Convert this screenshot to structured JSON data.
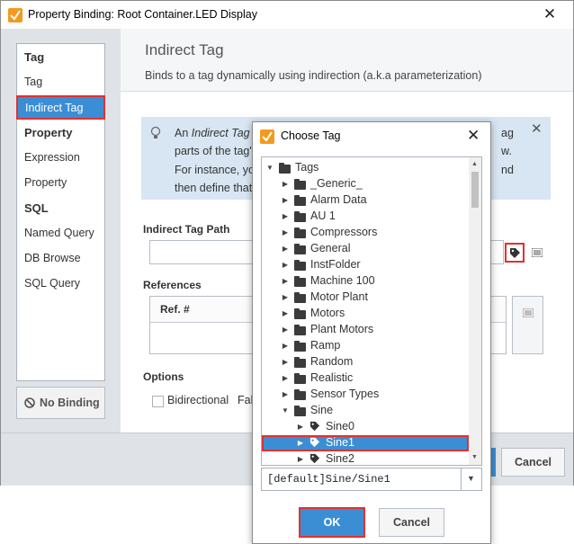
{
  "window": {
    "title": "Property Binding: Root Container.LED Display",
    "close_glyph": "✕"
  },
  "sidebar": {
    "tag_header": "Tag",
    "tag": "Tag",
    "indirect_tag": "Indirect Tag",
    "property_header": "Property",
    "expression": "Expression",
    "property": "Property",
    "sql_header": "SQL",
    "named_query": "Named Query",
    "db_browse": "DB Browse",
    "sql_query": "SQL Query",
    "no_binding": "No Binding"
  },
  "content": {
    "title": "Indirect Tag",
    "description": "Binds to a tag dynamically using indirection (a.k.a parameterization)",
    "info": {
      "line1_prefix": "An ",
      "line1_italic": "Indirect Tag B",
      "line1_tail": "ag",
      "line2_start": "parts of the tag'",
      "line2_end": "w.",
      "line3_start": "For instance, you",
      "line3_end": "nd",
      "line4_start": "then define that"
    },
    "indirect_tag_path_label": "Indirect Tag Path",
    "references_label": "References",
    "ref_col": "Ref. #",
    "options_label": "Options",
    "bidirectional_label": "Bidirectional",
    "fall_partial": "Fall"
  },
  "footer": {
    "cancel": "Cancel"
  },
  "dialog": {
    "title": "Choose Tag",
    "close_glyph": "✕",
    "tree": [
      {
        "label": "Tags",
        "icon": "folder-icon",
        "arrow": "expanded",
        "level": 0
      },
      {
        "label": "_Generic_",
        "icon": "folder-icon",
        "arrow": "collapsed",
        "level": 1
      },
      {
        "label": "Alarm Data",
        "icon": "folder-icon",
        "arrow": "collapsed",
        "level": 1
      },
      {
        "label": "AU 1",
        "icon": "folder-icon",
        "arrow": "collapsed",
        "level": 1
      },
      {
        "label": "Compressors",
        "icon": "folder-icon",
        "arrow": "collapsed",
        "level": 1
      },
      {
        "label": "General",
        "icon": "folder-icon",
        "arrow": "collapsed",
        "level": 1
      },
      {
        "label": "InstFolder",
        "icon": "folder-icon",
        "arrow": "collapsed",
        "level": 1
      },
      {
        "label": "Machine 100",
        "icon": "folder-icon",
        "arrow": "collapsed",
        "level": 1
      },
      {
        "label": "Motor Plant",
        "icon": "folder-icon",
        "arrow": "collapsed",
        "level": 1
      },
      {
        "label": "Motors",
        "icon": "folder-icon",
        "arrow": "collapsed",
        "level": 1
      },
      {
        "label": "Plant Motors",
        "icon": "folder-icon",
        "arrow": "collapsed",
        "level": 1
      },
      {
        "label": "Ramp",
        "icon": "folder-icon",
        "arrow": "collapsed",
        "level": 1
      },
      {
        "label": "Random",
        "icon": "folder-icon",
        "arrow": "collapsed",
        "level": 1
      },
      {
        "label": "Realistic",
        "icon": "folder-icon",
        "arrow": "collapsed",
        "level": 1
      },
      {
        "label": "Sensor Types",
        "icon": "folder-icon",
        "arrow": "collapsed",
        "level": 1
      },
      {
        "label": "Sine",
        "icon": "folder-icon",
        "arrow": "expanded",
        "level": 1
      },
      {
        "label": "Sine0",
        "icon": "tag-icon",
        "arrow": "collapsed",
        "level": 2
      },
      {
        "label": "Sine1",
        "icon": "tag-icon",
        "arrow": "collapsed",
        "level": 2,
        "selected": true
      },
      {
        "label": "Sine2",
        "icon": "tag-icon",
        "arrow": "collapsed",
        "level": 2
      }
    ],
    "selected_path": "[default]Sine/Sine1",
    "ok": "OK",
    "cancel": "Cancel"
  },
  "colors": {
    "selection_blue": "#3c8ed4",
    "highlight_red": "#e0322f",
    "info_bg": "#d7e6f2",
    "panel_gray": "#dfe3e7"
  }
}
